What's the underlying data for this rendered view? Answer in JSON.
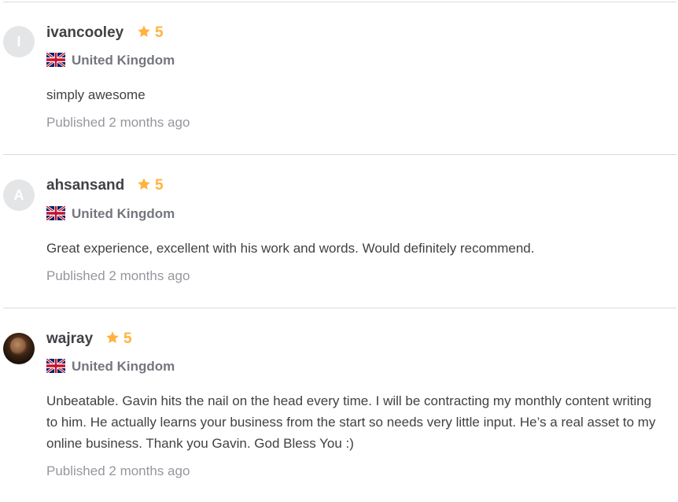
{
  "reviews": [
    {
      "avatar_initial": "I",
      "username": "ivancooley",
      "rating": "5",
      "country": "United Kingdom",
      "flag_icon": "uk-flag-icon",
      "text": "simply awesome",
      "published": "Published 2 months ago"
    },
    {
      "avatar_initial": "A",
      "username": "ahsansand",
      "rating": "5",
      "country": "United Kingdom",
      "flag_icon": "uk-flag-icon",
      "text": "Great experience, excellent with his work and words. Would definitely recommend.",
      "published": "Published 2 months ago"
    },
    {
      "avatar_initial": "",
      "username": "wajray",
      "rating": "5",
      "country": "United Kingdom",
      "flag_icon": "uk-flag-icon",
      "text": "Unbeatable. Gavin hits the nail on the head every time. I will be contracting my monthly content writing to him. He actually learns your business from the start so needs very little input. He’s a real asset to my online business. Thank you Gavin. God Bless You :)",
      "published": "Published 2 months ago"
    }
  ],
  "colors": {
    "star": "#ffb33e",
    "username": "#404145",
    "muted": "#74767e",
    "published": "#95979d",
    "divider": "#dadbdd"
  }
}
